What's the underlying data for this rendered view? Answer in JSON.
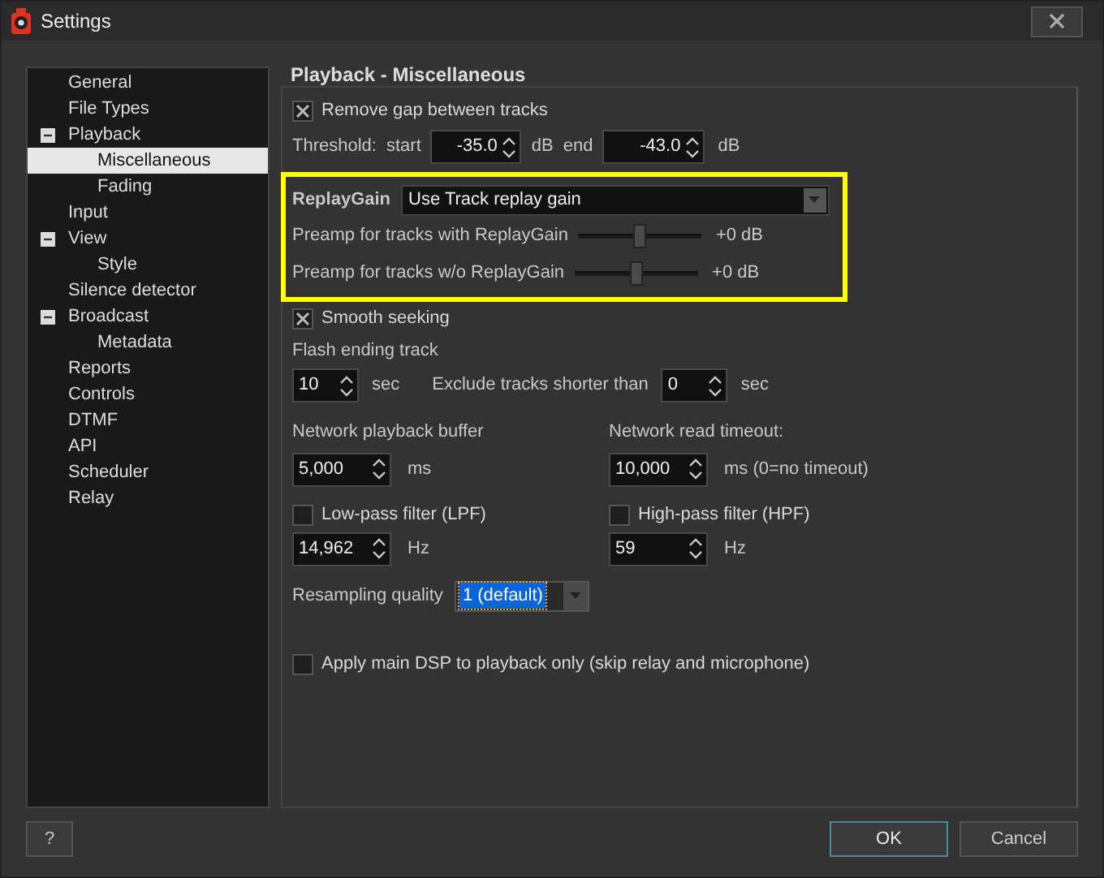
{
  "window": {
    "title": "Settings"
  },
  "sidebar": {
    "items": [
      {
        "label": "General",
        "selected": false
      },
      {
        "label": "File Types",
        "selected": false
      },
      {
        "label": "Playback",
        "selected": false,
        "expanded": true,
        "children": [
          {
            "label": "Miscellaneous",
            "selected": true
          },
          {
            "label": "Fading",
            "selected": false
          }
        ]
      },
      {
        "label": "Input",
        "selected": false
      },
      {
        "label": "View",
        "selected": false,
        "expanded": true,
        "children": [
          {
            "label": "Style",
            "selected": false
          }
        ]
      },
      {
        "label": "Silence detector",
        "selected": false
      },
      {
        "label": "Broadcast",
        "selected": false,
        "expanded": true,
        "children": [
          {
            "label": "Metadata",
            "selected": false
          }
        ]
      },
      {
        "label": "Reports",
        "selected": false
      },
      {
        "label": "Controls",
        "selected": false
      },
      {
        "label": "DTMF",
        "selected": false
      },
      {
        "label": "API",
        "selected": false
      },
      {
        "label": "Scheduler",
        "selected": false
      },
      {
        "label": "Relay",
        "selected": false
      }
    ]
  },
  "page_title": "Playback - Miscellaneous",
  "remove_gap": {
    "label": "Remove gap between tracks",
    "checked": true
  },
  "threshold": {
    "label": "Threshold:",
    "start_label": "start",
    "start": "-35.0",
    "unit1": "dB",
    "end_label": "end",
    "end": "-43.0",
    "unit2": "dB"
  },
  "replaygain": {
    "label": "ReplayGain",
    "value": "Use Track replay gain",
    "preamps": [
      {
        "label": "Preamp for tracks with ReplayGain",
        "level": 0.5,
        "reading": "+0 dB"
      },
      {
        "label": "Preamp for tracks w/o ReplayGain",
        "level": 0.5,
        "reading": "+0 dB"
      }
    ]
  },
  "smooth_seeking": {
    "label": "Smooth seeking",
    "checked": true
  },
  "flash": {
    "label": "Flash ending track",
    "value": "10",
    "unit": "sec",
    "exclude_label": "Exclude tracks shorter than",
    "exclude_value": "0",
    "exclude_unit": "sec"
  },
  "network_buffer": {
    "label": "Network playback buffer",
    "value": "5,000",
    "unit": "ms"
  },
  "network_timeout": {
    "label": "Network read timeout:",
    "value": "10,000",
    "unit": "ms (0=no timeout)"
  },
  "lpf": {
    "label": "Low-pass filter (LPF)",
    "checked": false,
    "value": "14,962",
    "unit": "Hz"
  },
  "hpf": {
    "label": "High-pass filter (HPF)",
    "checked": false,
    "value": "59",
    "unit": "Hz"
  },
  "resampling": {
    "label": "Resampling quality",
    "value": "1 (default)"
  },
  "apply_dsp": {
    "label": "Apply main DSP to playback only (skip relay and microphone)",
    "checked": false
  },
  "buttons": {
    "help": "?",
    "ok": "OK",
    "cancel": "Cancel"
  }
}
